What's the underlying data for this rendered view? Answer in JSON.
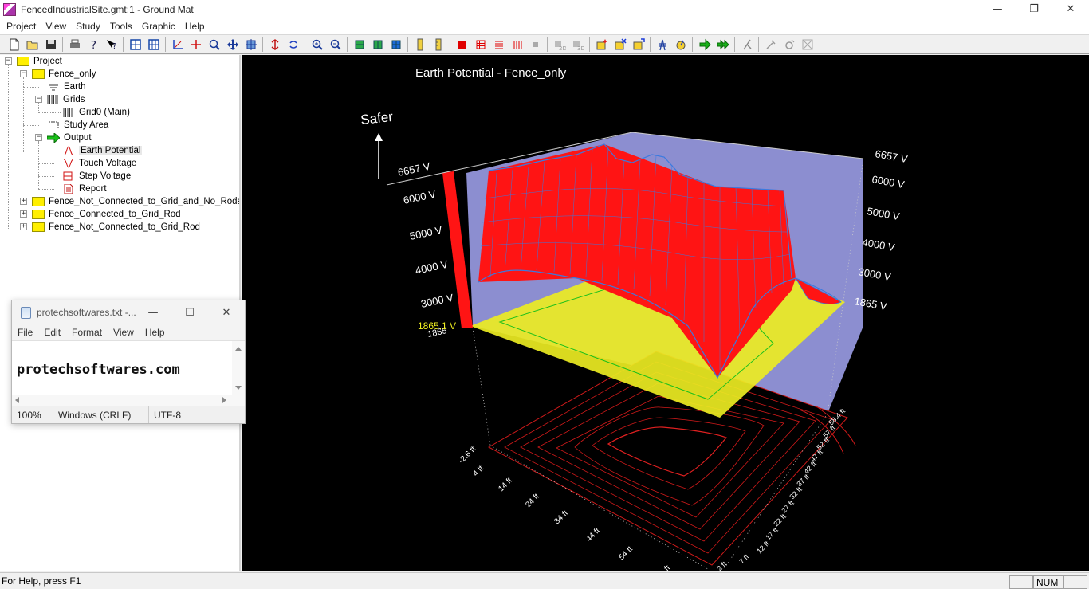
{
  "window": {
    "title": "FencedIndustrialSite.gmt:1 - Ground Mat",
    "minimize": "—",
    "restore": "❐",
    "close": "✕"
  },
  "menu": [
    "Project",
    "View",
    "Study",
    "Tools",
    "Graphic",
    "Help"
  ],
  "toolbar_icons": [
    "new-file-icon",
    "open-folder-icon",
    "save-icon",
    "print-icon",
    "help-icon",
    "context-help-icon",
    "grid-select-icon",
    "grid-select-2-icon",
    "axis-icon",
    "axis-2-icon",
    "zoom-icon",
    "pan-icon",
    "fit-icon",
    "rotate-icon",
    "rotate-2-icon",
    "zoom-in-icon",
    "zoom-out-icon",
    "layer-1-icon",
    "layer-2-icon",
    "layer-3-icon",
    "ruler-vertical-icon",
    "ruler-vertical-2-icon",
    "red-square-icon",
    "red-grid-icon",
    "red-lines-icon",
    "red-bars-icon",
    "gray-square-icon",
    "2d-view-icon",
    "3d-view-icon",
    "new-item-icon",
    "delete-item-icon",
    "move-item-icon",
    "tower-icon",
    "refresh-icon",
    "run-icon",
    "run-all-icon",
    "probe-icon",
    "tools-icon",
    "settings-icon",
    "grid-disabled-icon"
  ],
  "tree": {
    "root": "Project",
    "study": "Fence_only",
    "earth": "Earth",
    "grids": "Grids",
    "grid0": "Grid0 (Main)",
    "study_area": "Study Area",
    "output": "Output",
    "earth_potential": "Earth Potential",
    "touch_voltage": "Touch Voltage",
    "step_voltage": "Step Voltage",
    "report": "Report",
    "other_studies": [
      "Fence_Not_Connected_to_Grid_and_No_Rods",
      "Fence_Connected_to_Grid_Rod",
      "Fence_Not_Connected_to_Grid_Rod"
    ]
  },
  "plot": {
    "title": "Earth Potential - Fence_only",
    "safer": "Safer",
    "left_axis": [
      "6657 V",
      "6000 V",
      "5000 V",
      "4000 V",
      "3000 V",
      "1865.1 V"
    ],
    "left_axis_extra": "1865",
    "right_axis": [
      "6657 V",
      "6000 V",
      "5000 V",
      "4000 V",
      "3000 V",
      "1865 V"
    ],
    "x_axis": [
      "-2.6 ft",
      "4 ft",
      "14 ft",
      "24 ft",
      "34 ft",
      "44 ft",
      "54 ft",
      "ft"
    ],
    "y_axis": [
      "58.4 ft",
      "57 ft",
      "52 ft",
      "47 ft",
      "42 ft",
      "37 ft",
      "32 ft",
      "27 ft",
      "22 ft",
      "17 ft",
      "12 ft",
      "7 ft",
      "2 ft"
    ],
    "colors": {
      "surface": "#ff1f1f",
      "mesh": "#2a6ad8",
      "plane": "#f0f02a",
      "backwall": "#9a9be0",
      "contour": "#ff2a2a"
    }
  },
  "notepad": {
    "title": "protechsoftwares.txt -...",
    "menu": [
      "File",
      "Edit",
      "Format",
      "View",
      "Help"
    ],
    "content": "protechsoftwares.com",
    "zoom": "100%",
    "eol": "Windows (CRLF)",
    "encoding": "UTF-8"
  },
  "status": {
    "help": "For Help, press F1",
    "num": "NUM"
  }
}
